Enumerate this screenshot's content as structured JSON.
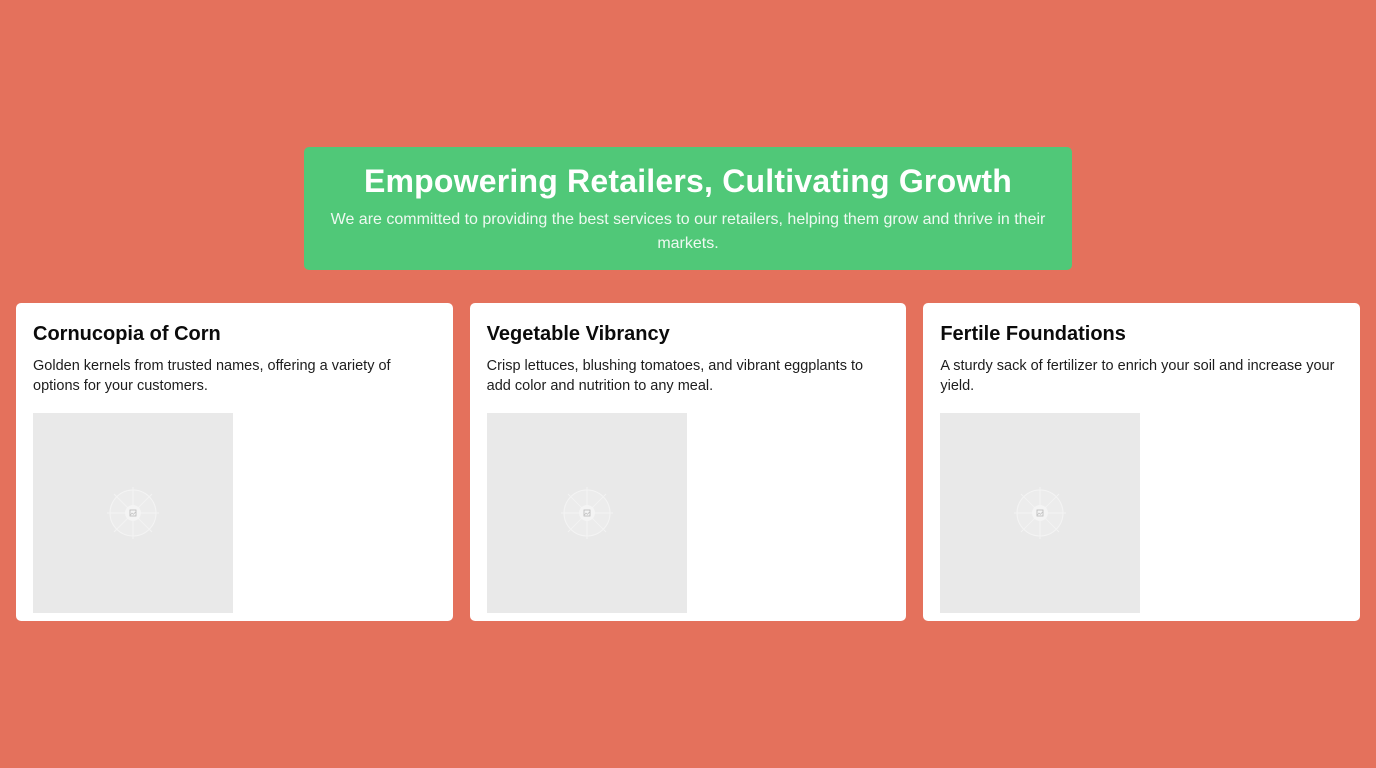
{
  "hero": {
    "title": "Empowering Retailers, Cultivating Growth",
    "subtitle": "We are committed to providing the best services to our retailers, helping them grow and thrive in their markets."
  },
  "cards": [
    {
      "title": "Cornucopia of Corn",
      "description": "Golden kernels from trusted names, offering a variety of options for your customers.",
      "image_icon": "image-placeholder-icon"
    },
    {
      "title": "Vegetable Vibrancy",
      "description": "Crisp lettuces, blushing tomatoes, and vibrant eggplants to add color and nutrition to any meal.",
      "image_icon": "image-placeholder-icon"
    },
    {
      "title": "Fertile Foundations",
      "description": "A sturdy sack of fertilizer to enrich your soil and increase your yield.",
      "image_icon": "image-placeholder-icon"
    }
  ],
  "colors": {
    "page_background": "#e4715c",
    "hero_background": "#50c878",
    "card_background": "#ffffff",
    "placeholder_background": "#e9e9e9"
  }
}
